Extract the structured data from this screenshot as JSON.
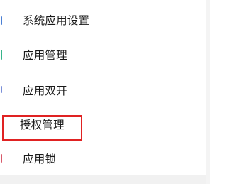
{
  "menu": {
    "items": [
      {
        "label": "系统应用设置",
        "icon": "system-app-settings-icon",
        "color": "#4a7fd4"
      },
      {
        "label": "应用管理",
        "icon": "app-management-icon",
        "color": "#38b48b"
      },
      {
        "label": "应用双开",
        "icon": "app-clone-icon",
        "color": "#7a8fd8"
      },
      {
        "label": "授权管理",
        "icon": "permission-management-icon",
        "color": "#ffffff"
      },
      {
        "label": "应用锁",
        "icon": "app-lock-icon",
        "color": "#d85a6a"
      }
    ]
  },
  "highlight_color": "#e02222"
}
